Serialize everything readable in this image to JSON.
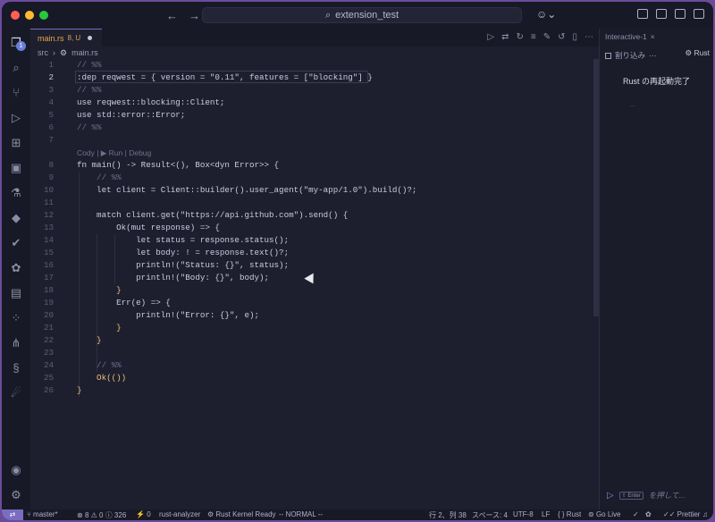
{
  "titlebar": {
    "search_text": "extension_test",
    "colors": {
      "close": "#ff5f57",
      "minimize": "#febc2e",
      "zoom": "#28c840"
    }
  },
  "activity": {
    "source_control_badge": "1"
  },
  "tab": {
    "file": "main.rs",
    "status": "8, U"
  },
  "breadcrumb": {
    "folder": "src",
    "file": "main.rs"
  },
  "code_lens": "Cody | ▶ Run | Debug",
  "lines": [
    {
      "n": "1",
      "text": "// %%"
    },
    {
      "n": "2",
      "text": ":dep reqwest = { version = \"0.11\", features = [\"blocking\"] }"
    },
    {
      "n": "3",
      "text": "// %%"
    },
    {
      "n": "4",
      "text": "use reqwest::blocking::Client;"
    },
    {
      "n": "5",
      "text": "use std::error::Error;"
    },
    {
      "n": "6",
      "text": "// %%"
    },
    {
      "n": "7",
      "text": ""
    },
    {
      "n": "8",
      "text": "fn main() -> Result<(), Box<dyn Error>> {"
    },
    {
      "n": "9",
      "text": "    // %%"
    },
    {
      "n": "10",
      "text": "    let client = Client::builder().user_agent(\"my-app/1.0\").build()?;"
    },
    {
      "n": "11",
      "text": ""
    },
    {
      "n": "12",
      "text": "    match client.get(\"https://api.github.com\").send() {"
    },
    {
      "n": "13",
      "text": "        Ok(mut response) => {"
    },
    {
      "n": "14",
      "text": "            let status = response.status();"
    },
    {
      "n": "15",
      "text": "            let body: ! = response.text()?;"
    },
    {
      "n": "16",
      "text": "            println!(\"Status: {}\", status);"
    },
    {
      "n": "17",
      "text": "            println!(\"Body: {}\", body);"
    },
    {
      "n": "18",
      "text": "        }"
    },
    {
      "n": "19",
      "text": "        Err(e) => {"
    },
    {
      "n": "20",
      "text": "            println!(\"Error: {}\", e);"
    },
    {
      "n": "21",
      "text": "        }"
    },
    {
      "n": "22",
      "text": "    }"
    },
    {
      "n": "23",
      "text": ""
    },
    {
      "n": "24",
      "text": "    // %%"
    },
    {
      "n": "25",
      "text": "    Ok(())"
    },
    {
      "n": "26",
      "text": "}"
    }
  ],
  "panel": {
    "tab_label": "Interactive-1",
    "interrupt_label": "割り込み",
    "kernel_label": "Rust",
    "message": "Rust の再起動完了",
    "ellipsis": "...",
    "input_key": "⇧ Enter",
    "input_hint": "を押して..."
  },
  "status": {
    "branch": "master*",
    "errors": "8",
    "warnings": "0",
    "info": "326",
    "ports": "0",
    "analyzer": "rust-analyzer",
    "kernel": "Rust Kernel Ready",
    "mode": "-- NORMAL --",
    "position": "行 2、列 38",
    "spaces": "スペース: 4",
    "encoding": "UTF-8",
    "eol": "LF",
    "language": "Rust",
    "golive": "Go Live",
    "prettier": "Prettier"
  }
}
